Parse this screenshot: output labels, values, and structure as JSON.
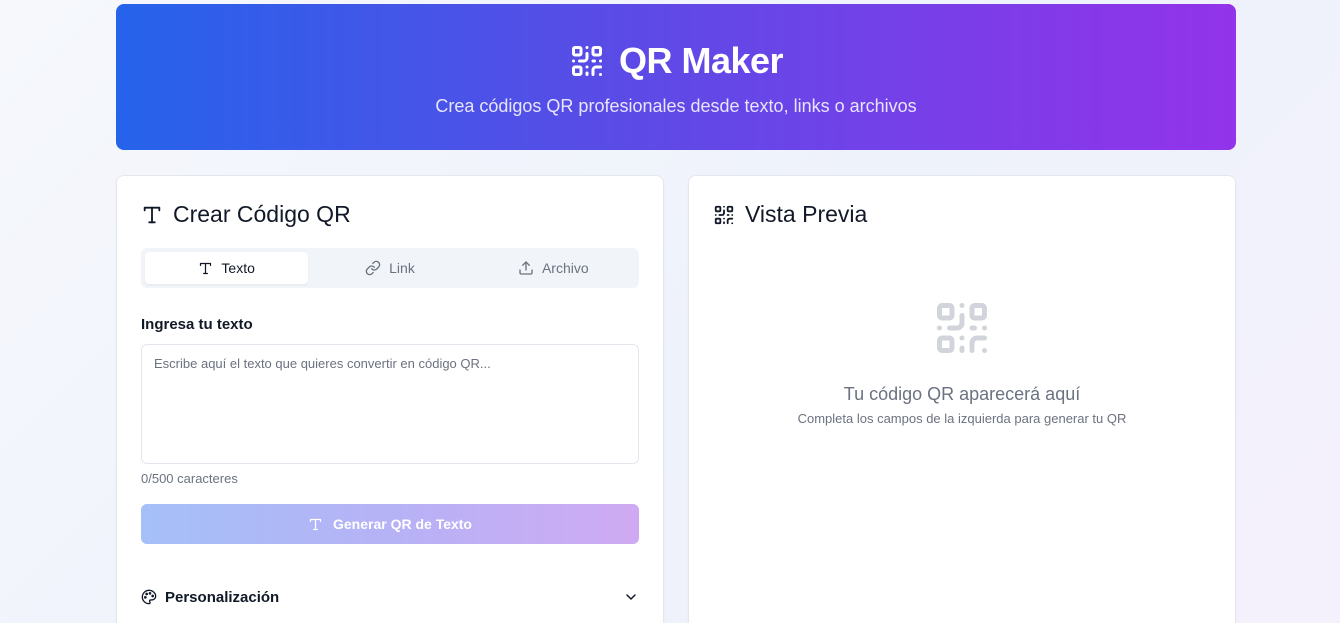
{
  "header": {
    "title": "QR Maker",
    "subtitle": "Crea códigos QR profesionales desde texto, links o archivos",
    "icon": "qr-code-icon"
  },
  "create_panel": {
    "title": "Crear Código QR",
    "icon": "type-icon",
    "tabs": [
      {
        "label": "Texto",
        "icon": "type-icon",
        "active": true
      },
      {
        "label": "Link",
        "icon": "link-icon",
        "active": false
      },
      {
        "label": "Archivo",
        "icon": "upload-icon",
        "active": false
      }
    ],
    "text_input": {
      "label": "Ingresa tu texto",
      "placeholder": "Escribe aquí el texto que quieres convertir en código QR...",
      "value": "",
      "char_count": "0/500 caracteres"
    },
    "generate_button": {
      "label": "Generar QR de Texto",
      "icon": "type-icon",
      "disabled": true
    },
    "customization": {
      "label": "Personalización",
      "icon": "palette-icon",
      "expanded": false
    }
  },
  "preview_panel": {
    "title": "Vista Previa",
    "icon": "qr-code-icon",
    "empty_title": "Tu código QR aparecerá aquí",
    "empty_subtitle": "Completa los campos de la izquierda para generar tu QR"
  },
  "colors": {
    "gradient_start": "#2563eb",
    "gradient_end": "#9333ea",
    "text_primary": "#111827",
    "text_muted": "#6b7280"
  }
}
